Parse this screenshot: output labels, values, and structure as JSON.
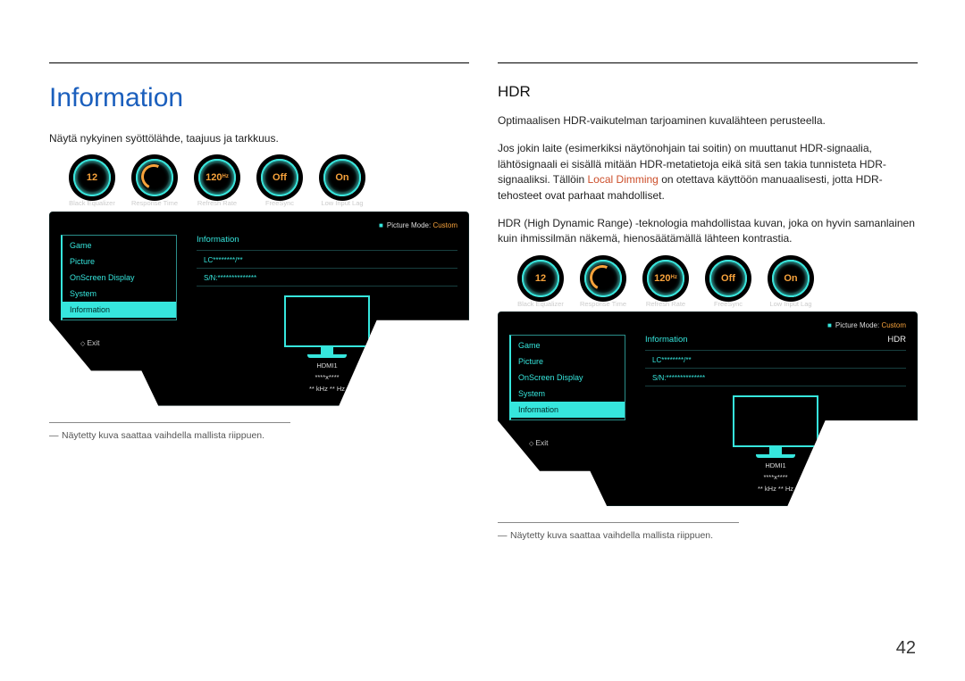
{
  "page_number": "42",
  "left": {
    "title": "Information",
    "desc": "Näytä nykyinen syöttölähde, taajuus ja tarkkuus.",
    "footnote": "Näytetty kuva saattaa vaihdella mallista riippuen."
  },
  "right": {
    "title": "HDR",
    "desc1": "Optimaalisen HDR-vaikutelman tarjoaminen kuvalähteen perusteella.",
    "desc2_a": "Jos jokin laite (esimerkiksi näytönohjain tai soitin) on muuttanut HDR-signaalia, lähtösignaali ei sisällä mitään HDR-metatietoja eikä sitä sen takia tunnisteta HDR-signaaliksi. Tällöin ",
    "desc2_accent": "Local Dimming",
    "desc2_b": " on otettava käyttöön manuaalisesti, jotta HDR-tehosteet ovat parhaat mahdolliset.",
    "desc3": "HDR (High Dynamic Range) -teknologia mahdollistaa kuvan, joka on hyvin samanlainen kuin ihmissilmän näkemä, hienosäätämällä lähteen kontrastia.",
    "footnote": "Näytetty kuva saattaa vaihdella mallista riippuen."
  },
  "osd": {
    "dials": [
      {
        "value": "12",
        "sub": "",
        "label": "Black Equalizer"
      },
      {
        "value": "",
        "sub": "",
        "label": "Response Time"
      },
      {
        "value": "120",
        "sub": "Hz",
        "label": "Refresh Rate"
      },
      {
        "value": "Off",
        "sub": "",
        "label": "FreeSync"
      },
      {
        "value": "On",
        "sub": "",
        "label": "Low Input Lag"
      }
    ],
    "picture_mode_label": "Picture Mode: ",
    "picture_mode_value": "Custom",
    "nav": [
      "Game",
      "Picture",
      "OnScreen Display",
      "System",
      "Information"
    ],
    "nav_active_index": 4,
    "info_title": "Information",
    "hdr_label": "HDR",
    "model": "LC********/**",
    "serial": "S/N:**************",
    "mon_lines": [
      "HDMI1",
      "****x****",
      "** kHz  ** Hz"
    ],
    "exit": "Exit"
  }
}
